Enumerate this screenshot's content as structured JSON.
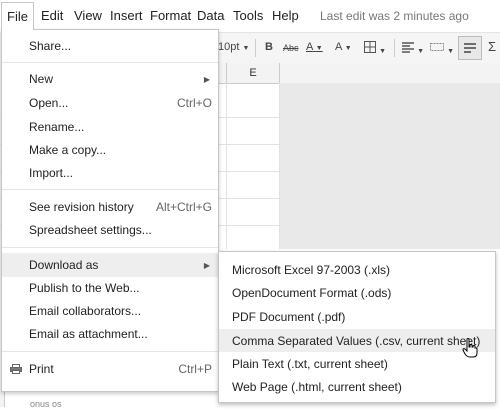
{
  "menubar": {
    "items": [
      "File",
      "Edit",
      "View",
      "Insert",
      "Format",
      "Data",
      "Tools",
      "Help"
    ],
    "last_edit": "Last edit was 2 minutes ago"
  },
  "toolbar": {
    "font_size": "10pt",
    "bold": "B",
    "strike": "Abc",
    "text_color": "A",
    "fill_color": "A",
    "sigma": "Σ"
  },
  "sheet": {
    "column_e": "E",
    "bottom_text": "onus os"
  },
  "file_menu": {
    "share": "Share...",
    "new": "New",
    "open": "Open...",
    "open_shortcut": "Ctrl+O",
    "rename": "Rename...",
    "make_copy": "Make a copy...",
    "import": "Import...",
    "revision_history": "See revision history",
    "revision_shortcut": "Alt+Ctrl+G",
    "spreadsheet_settings": "Spreadsheet settings...",
    "download_as": "Download as",
    "publish": "Publish to the Web...",
    "email_collaborators": "Email collaborators...",
    "email_attachment": "Email as attachment...",
    "print": "Print",
    "print_shortcut": "Ctrl+P"
  },
  "download_submenu": {
    "items": [
      "Microsoft Excel 97-2003 (.xls)",
      "OpenDocument Format (.ods)",
      "PDF Document (.pdf)",
      "Comma Separated Values (.csv, current sheet)",
      "Plain Text (.txt, current sheet)",
      "Web Page (.html, current sheet)"
    ],
    "highlighted": "Comma Separated Values (.csv, current sheet)"
  },
  "colors": {
    "highlight": "#eeeeee",
    "menu_border": "#c6c6c6",
    "toolbar_bg": "#f5f5f5",
    "grey_area": "#e9e9e9"
  }
}
